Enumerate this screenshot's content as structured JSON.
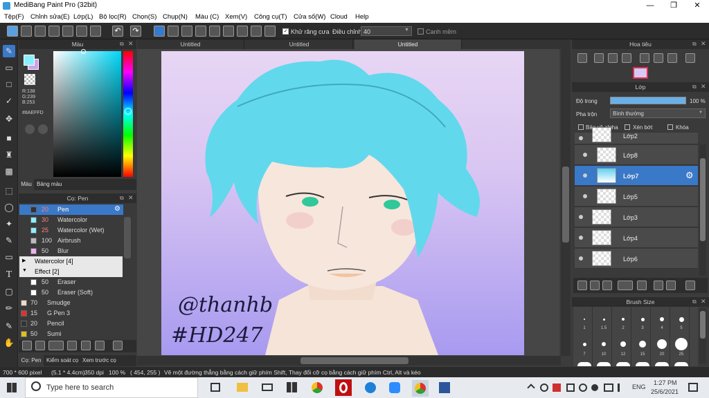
{
  "window": {
    "title": "MediBang Paint Pro (32bit)"
  },
  "menu": [
    "Tệp(F)",
    "Chỉnh sửa(E)",
    "Lớp(L)",
    "Bộ lọc(R)",
    "Chọn(S)",
    "Chụp(N)",
    "Màu (C)",
    "Xem(V)",
    "Công cụ(T)",
    "Cửa số(W)",
    "Cloud",
    "Help"
  ],
  "toolbar": {
    "antialias_label": "Khử răng cưa",
    "adjust_label": "Điều chỉnh",
    "adjust_value": "40",
    "snap_label": "Canh mềm"
  },
  "color_panel": {
    "title": "Màu",
    "r": "R:138",
    "g": "G:239",
    "b": "B:253",
    "hex": "#8AEFFD",
    "tab_color": "Màu",
    "tab_palette": "Bảng màu",
    "fg_color": "#8AEFFD"
  },
  "brush_panel": {
    "title": "Cọ: Pen",
    "items": [
      {
        "size": "20",
        "name": "Pen",
        "color": "#333333",
        "selected": true
      },
      {
        "size": "30",
        "name": "Watercolor",
        "color": "#8AEFFD"
      },
      {
        "size": "25",
        "name": "Watercolor (Wet)",
        "color": "#8AEFFD"
      },
      {
        "size": "100",
        "name": "Airbrush",
        "color": "#bbbbbb"
      },
      {
        "size": "50",
        "name": "Blur",
        "color": "#f0b0f0"
      }
    ],
    "group_watercolor": "Watercolor [4]",
    "group_effect": "Effect [2]",
    "effect_items": [
      {
        "size": "50",
        "name": "Eraser",
        "color": "#ffffff"
      },
      {
        "size": "50",
        "name": "Eraser (Soft)",
        "color": "#ffffff"
      }
    ],
    "more": [
      {
        "size": "70",
        "name": "Smudge",
        "color": "#f0d8c8"
      },
      {
        "size": "15",
        "name": "G Pen 3",
        "color": "#e03030"
      },
      {
        "size": "20",
        "name": "Pencil",
        "color": "#333333"
      },
      {
        "size": "50",
        "name": "Sumi",
        "color": "#e0c020"
      }
    ],
    "tab_brush": "Cọ: Pen",
    "tab_control": "Kiểm soát cọ",
    "tab_preview": "Xem trước cọ"
  },
  "docs": [
    "Untitled",
    "Untitled",
    "Untitled"
  ],
  "navigator": {
    "title": "Hoa tiêu"
  },
  "layer_panel": {
    "title": "Lớp",
    "opacity_label": "Độ trong",
    "opacity_value": "100 %",
    "blend_label": "Pha trộn",
    "blend_value": "Bình thường",
    "protect_alpha": "Bảo vệ alpha",
    "clip": "Xén bớt",
    "lock": "Khóa",
    "layers": [
      "Lớp2",
      "Lớp8",
      "Lớp7",
      "Lớp5",
      "Lớp3",
      "Lớp4",
      "Lớp6"
    ],
    "selected": "Lớp7"
  },
  "brush_size": {
    "title": "Brush Size",
    "labels1": [
      "1",
      "1.5",
      "2",
      "3",
      "4",
      "5"
    ],
    "labels2": [
      "7",
      "10",
      "12",
      "15",
      "20",
      "25"
    ]
  },
  "artwork": {
    "signature1": "@thanhb",
    "signature2": "#HD247"
  },
  "status": {
    "dims": "700 * 600 pixel",
    "cm": "(5.1 * 4.4cm)",
    "dpi": "350 dpi",
    "zoom": "100 %",
    "coords": "( 454, 255 )",
    "hint": "Vẽ một đường thẳng bằng cách giữ phím Shift, Thay đổi cỡ cọ bằng cách giữ phím Ctrl, Alt và kéo"
  },
  "taskbar": {
    "search": "Type here to search",
    "lang": "ENG",
    "time": "1:27 PM",
    "date": "25/6/2021"
  }
}
